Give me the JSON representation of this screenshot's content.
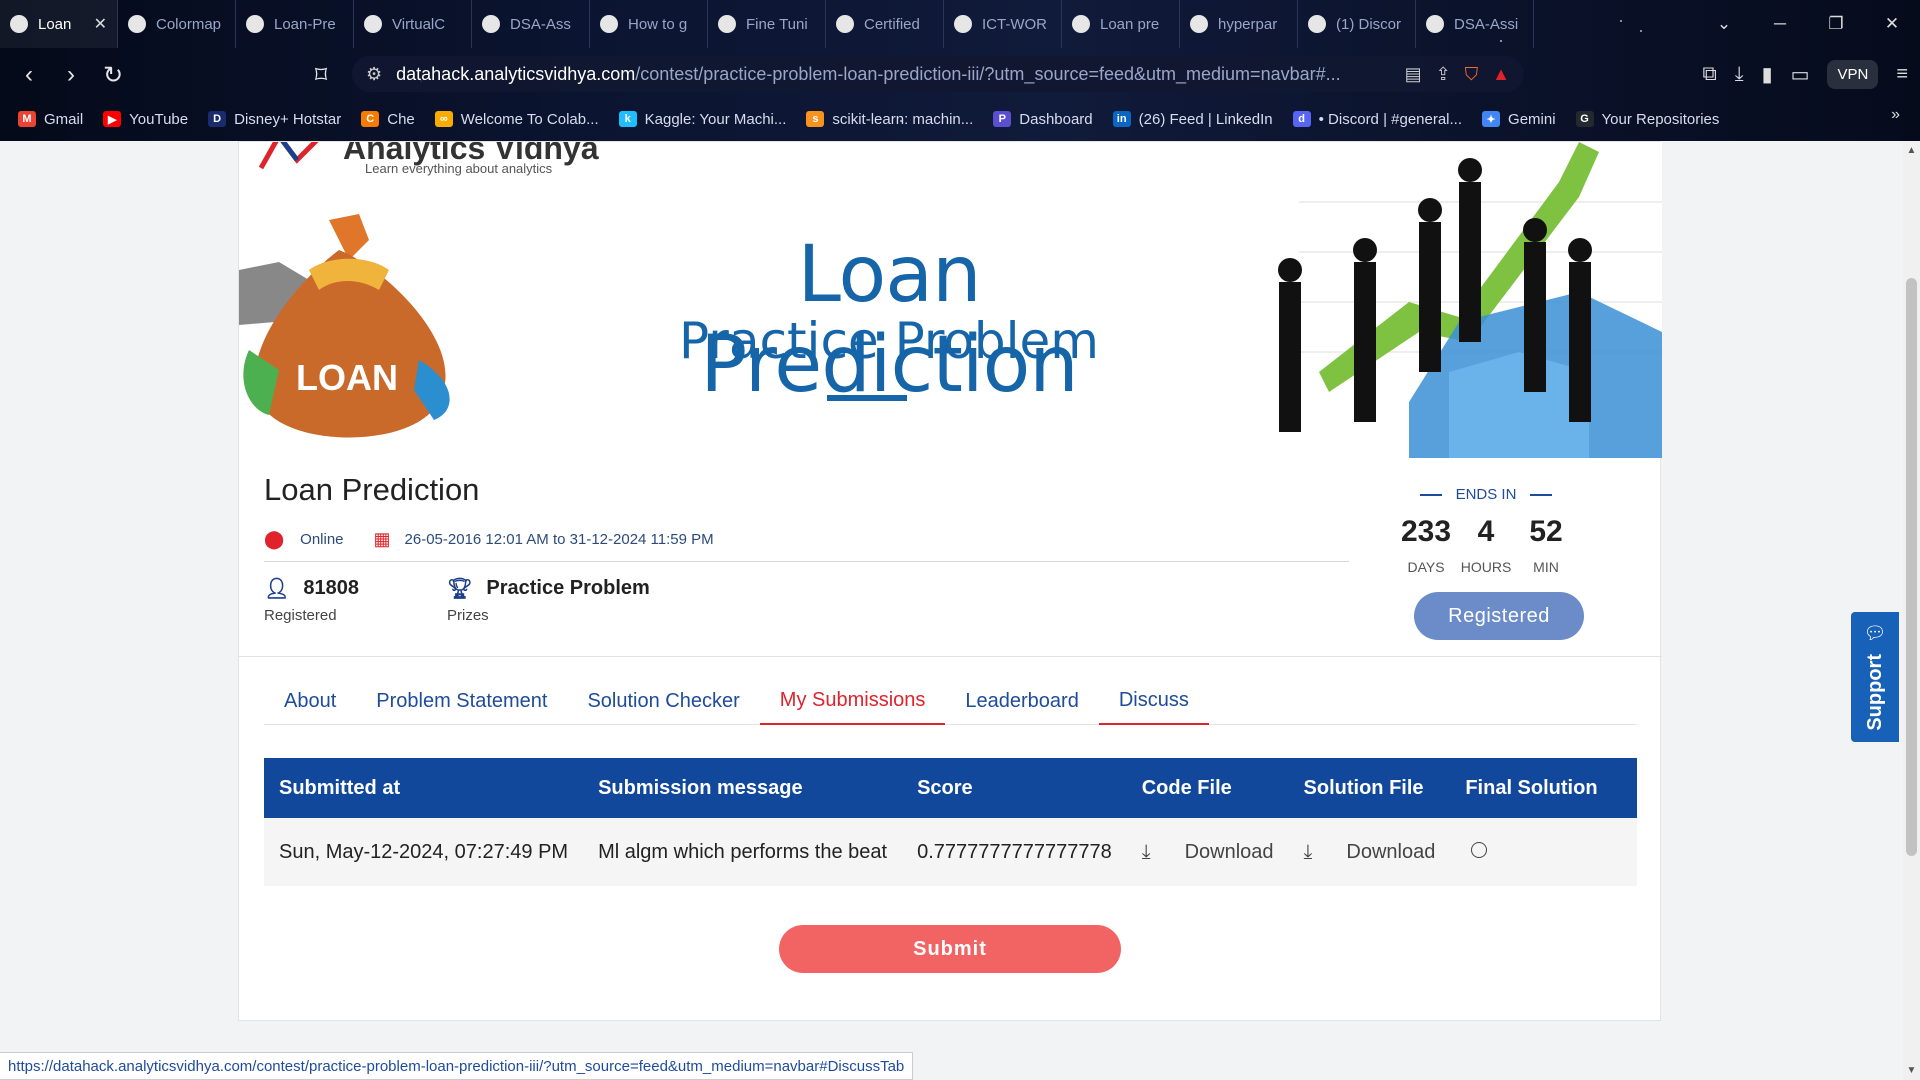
{
  "browser": {
    "tabs": [
      {
        "title": "Loan",
        "icon": "av-icon",
        "active": true
      },
      {
        "title": "Colormap",
        "icon": "chatgpt-icon"
      },
      {
        "title": "Loan-Pre",
        "icon": "github-icon"
      },
      {
        "title": "VirtualC",
        "icon": "ms-icon"
      },
      {
        "title": "DSA-Ass",
        "icon": "github-icon"
      },
      {
        "title": "How to g",
        "icon": "medium-icon"
      },
      {
        "title": "Fine Tuni",
        "icon": "medium-icon"
      },
      {
        "title": "Certified",
        "icon": "p-icon"
      },
      {
        "title": "ICT-WOR",
        "icon": "github-icon"
      },
      {
        "title": "Loan pre",
        "icon": "colab-icon"
      },
      {
        "title": "hyperpar",
        "icon": "google-icon"
      },
      {
        "title": "(1) Discor",
        "icon": "discord-icon"
      },
      {
        "title": "DSA-Assi",
        "icon": "github-icon"
      }
    ],
    "tab_close": "✕",
    "address": {
      "domain": "datahack.analyticsvidhya.com",
      "path": "/contest/practice-problem-loan-prediction-iii/?utm_source=feed&utm_medium=navbar#..."
    },
    "vpn_label": "VPN",
    "bookmarks": [
      {
        "label": "Gmail",
        "color": "#ea4335",
        "glyph": "M"
      },
      {
        "label": "YouTube",
        "color": "#ff0000",
        "glyph": "▶"
      },
      {
        "label": "Disney+ Hotstar",
        "color": "#1a2c6b",
        "glyph": "D"
      },
      {
        "label": "Che",
        "color": "#f57c00",
        "glyph": "C"
      },
      {
        "label": "Welcome To Colab...",
        "color": "#f9ab00",
        "glyph": "∞"
      },
      {
        "label": "Kaggle: Your Machi...",
        "color": "#20beff",
        "glyph": "k"
      },
      {
        "label": "scikit-learn: machin...",
        "color": "#f7931e",
        "glyph": "s"
      },
      {
        "label": "Dashboard",
        "color": "#5a4fcf",
        "glyph": "P"
      },
      {
        "label": "(26) Feed | LinkedIn",
        "color": "#0a66c2",
        "glyph": "in"
      },
      {
        "label": "• Discord | #general...",
        "color": "#5865f2",
        "glyph": "d"
      },
      {
        "label": "Gemini",
        "color": "#4285f4",
        "glyph": "✦"
      },
      {
        "label": "Your Repositories",
        "color": "#24292e",
        "glyph": "G"
      }
    ]
  },
  "banner": {
    "logo_text": "Analytics Vidhya",
    "logo_tagline": "Learn everything about analytics",
    "bag_label": "LOAN",
    "title": "Loan Prediction",
    "subtitle": "Practice Problem"
  },
  "contest": {
    "title": "Loan Prediction",
    "location": "Online",
    "dates": "26-05-2016 12:01 AM to 31-12-2024 11:59 PM",
    "registered_count": "81808",
    "registered_label": "Registered",
    "prize_value": "Practice Problem",
    "prize_label": "Prizes",
    "ends_in_label": "ENDS IN",
    "countdown": [
      {
        "value": "233",
        "unit": "DAYS"
      },
      {
        "value": "4",
        "unit": "HOURS"
      },
      {
        "value": "52",
        "unit": "MIN"
      }
    ],
    "registered_button": "Registered"
  },
  "tabs": [
    "About",
    "Problem Statement",
    "Solution Checker",
    "My Submissions",
    "Leaderboard",
    "Discuss"
  ],
  "selected_tab": "My Submissions",
  "table": {
    "headers": [
      "Submitted at",
      "Submission message",
      "Score",
      "Code File",
      "Solution File",
      "Final Solution"
    ],
    "rows": [
      {
        "submitted_at": "Sun, May-12-2024, 07:27:49 PM",
        "message": "Ml algm which performs the beat",
        "score": "0.7777777777777778",
        "code_file": "Download",
        "solution_file": "Download"
      }
    ]
  },
  "submit_label": "Submit",
  "support_label": "Support",
  "status_url": "https://datahack.analyticsvidhya.com/contest/practice-problem-loan-prediction-iii/?utm_source=feed&utm_medium=navbar#DiscussTab",
  "colors": {
    "primary_blue": "#11489c",
    "accent_red": "#e0232b",
    "submit": "#f26363",
    "registered": "#6b8cc8"
  }
}
